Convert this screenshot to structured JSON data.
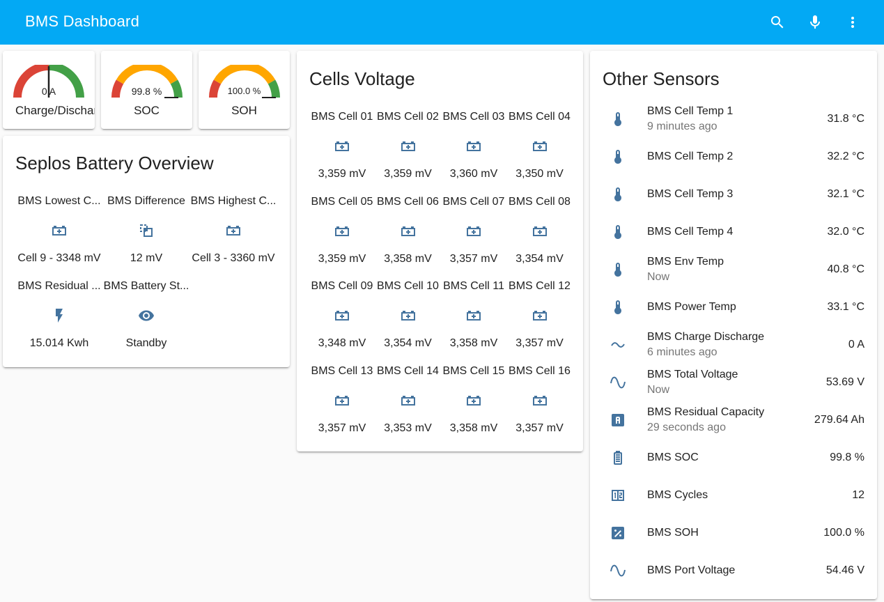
{
  "app": {
    "title": "BMS Dashboard",
    "accent": "#03a9f4",
    "icon_color": "#44739e"
  },
  "toolbar": {
    "icons": [
      "search-icon",
      "microphone-icon",
      "more-vert-icon"
    ]
  },
  "gauges": [
    {
      "name": "Charge/Discharge",
      "value_text": "0 A",
      "level": 0.5
    },
    {
      "name": "SOC",
      "value_text": "99.8 %",
      "level": 0.998
    },
    {
      "name": "SOH",
      "value_text": "100.0 %",
      "level": 1.0
    }
  ],
  "overview": {
    "title": "Seplos Battery Overview",
    "items": [
      {
        "name": "BMS Lowest C...",
        "icon": "battery-plus-icon",
        "value": "Cell 9 - 3348 mV"
      },
      {
        "name": "BMS Difference",
        "icon": "select-compare-icon",
        "value": "12 mV"
      },
      {
        "name": "BMS Highest C...",
        "icon": "battery-plus-icon",
        "value": "Cell 3 - 3360 mV"
      },
      {
        "name": "BMS Residual ...",
        "icon": "flash-icon",
        "value": "15.014 Kwh"
      },
      {
        "name": "BMS Battery St...",
        "icon": "eye-icon",
        "value": "Standby"
      }
    ]
  },
  "cells": {
    "title": "Cells Voltage",
    "items": [
      {
        "name": "BMS Cell 01",
        "value": "3,359 mV"
      },
      {
        "name": "BMS Cell 02",
        "value": "3,359 mV"
      },
      {
        "name": "BMS Cell 03",
        "value": "3,360 mV"
      },
      {
        "name": "BMS Cell 04",
        "value": "3,350 mV"
      },
      {
        "name": "BMS Cell 05",
        "value": "3,359 mV"
      },
      {
        "name": "BMS Cell 06",
        "value": "3,358 mV"
      },
      {
        "name": "BMS Cell 07",
        "value": "3,357 mV"
      },
      {
        "name": "BMS Cell 08",
        "value": "3,354 mV"
      },
      {
        "name": "BMS Cell 09",
        "value": "3,348 mV"
      },
      {
        "name": "BMS Cell 10",
        "value": "3,354 mV"
      },
      {
        "name": "BMS Cell 11",
        "value": "3,358 mV"
      },
      {
        "name": "BMS Cell 12",
        "value": "3,357 mV"
      },
      {
        "name": "BMS Cell 13",
        "value": "3,357 mV"
      },
      {
        "name": "BMS Cell 14",
        "value": "3,353 mV"
      },
      {
        "name": "BMS Cell 15",
        "value": "3,358 mV"
      },
      {
        "name": "BMS Cell 16",
        "value": "3,357 mV"
      }
    ]
  },
  "sensors": {
    "title": "Other Sensors",
    "items": [
      {
        "name": "BMS Cell Temp 1",
        "secondary": "9 minutes ago",
        "value": "31.8 °C",
        "icon": "thermometer-icon"
      },
      {
        "name": "BMS Cell Temp 2",
        "secondary": "",
        "value": "32.2 °C",
        "icon": "thermometer-icon"
      },
      {
        "name": "BMS Cell Temp 3",
        "secondary": "",
        "value": "32.1 °C",
        "icon": "thermometer-icon"
      },
      {
        "name": "BMS Cell Temp 4",
        "secondary": "",
        "value": "32.0 °C",
        "icon": "thermometer-icon"
      },
      {
        "name": "BMS Env Temp",
        "secondary": "Now",
        "value": "40.8 °C",
        "icon": "thermometer-icon"
      },
      {
        "name": "BMS Power Temp",
        "secondary": "",
        "value": "33.1 °C",
        "icon": "thermometer-icon"
      },
      {
        "name": "BMS Charge Discharge",
        "secondary": "6 minutes ago",
        "value": "0 A",
        "icon": "current-ac-icon"
      },
      {
        "name": "BMS Total Voltage",
        "secondary": "Now",
        "value": "53.69 V",
        "icon": "sine-wave-icon"
      },
      {
        "name": "BMS Residual Capacity",
        "secondary": "29 seconds ago",
        "value": "279.64 Ah",
        "icon": "alpha-a-box-icon"
      },
      {
        "name": "BMS SOC",
        "secondary": "",
        "value": "99.8 %",
        "icon": "battery-icon"
      },
      {
        "name": "BMS Cycles",
        "secondary": "",
        "value": "12",
        "icon": "numeric-box-icon"
      },
      {
        "name": "BMS SOH",
        "secondary": "",
        "value": "100.0 %",
        "icon": "percent-box-icon"
      },
      {
        "name": "BMS Port Voltage",
        "secondary": "",
        "value": "54.46 V",
        "icon": "sine-wave-icon"
      }
    ]
  }
}
